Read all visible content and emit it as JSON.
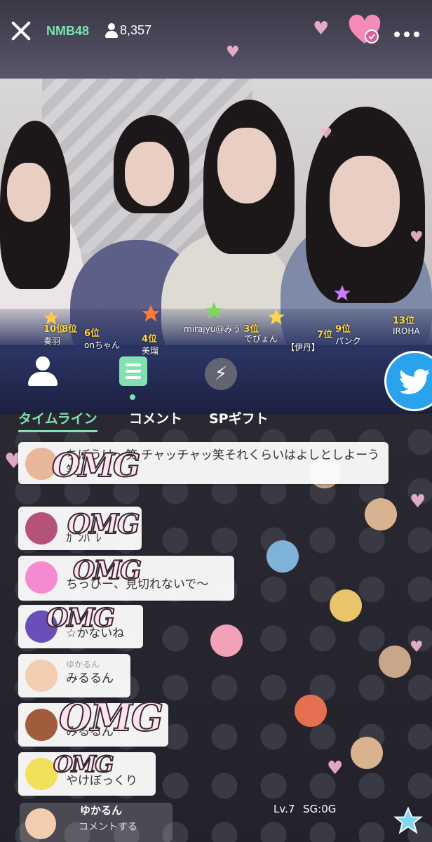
{
  "header": {
    "room_name": "NMB48",
    "viewer_count": "8,357"
  },
  "ranks": [
    {
      "pos": "10位",
      "name": "奏羽"
    },
    {
      "pos": "8位",
      "name": ""
    },
    {
      "pos": "6位",
      "name": "onちゃん"
    },
    {
      "pos": "4位",
      "name": "美瑠"
    },
    {
      "pos": "3位",
      "name": "mirajyu@みう"
    },
    {
      "pos": "",
      "name": "でびょん"
    },
    {
      "pos": "",
      "name": "【伊丹】"
    },
    {
      "pos": "7位",
      "name": ""
    },
    {
      "pos": "9位",
      "name": "パンク"
    },
    {
      "pos": "13位",
      "name": "IROHA"
    }
  ],
  "tabs": [
    {
      "label": "タイムライン",
      "active": true
    },
    {
      "label": "コメント",
      "active": false
    },
    {
      "label": "SPギフト",
      "active": false
    }
  ],
  "comments": [
    {
      "user": "",
      "text": "ちぼうけ〜笑 チャッチャッ笑それくらいはよしとしよーう笑"
    },
    {
      "user": "",
      "text": "ｶﾞﾝﾊﾞﾚ"
    },
    {
      "user": "",
      "text": "ちっひー、見切れないで〜"
    },
    {
      "user": "",
      "text": "☆かないね"
    },
    {
      "user": "ゆかるん",
      "text": "みるるん"
    },
    {
      "user": "",
      "text": "みるるん"
    },
    {
      "user": "",
      "text": "やけぼっくり"
    }
  ],
  "stickers": [
    "OMG",
    "OMG",
    "OMG",
    "OMG",
    "OMG",
    "OMG"
  ],
  "footer": {
    "username": "ゆかるん",
    "level": "Lv.7",
    "sg": "SG:0G",
    "hint": "コメントする"
  },
  "colors": {
    "accent": "#7fe2b0",
    "twitter": "#2aa3ef",
    "heart": "#f4b7d3"
  }
}
